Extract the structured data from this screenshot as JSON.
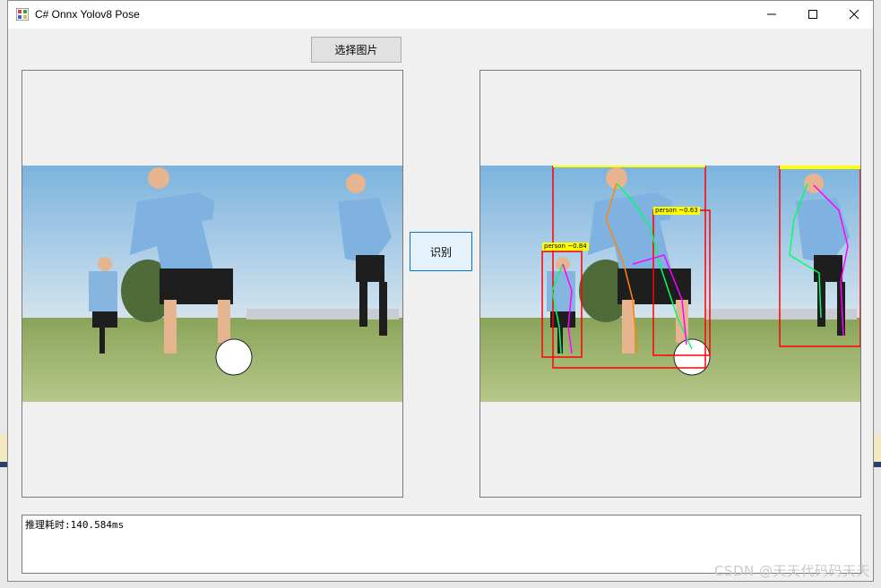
{
  "window": {
    "title": "C# Onnx Yolov8 Pose",
    "controls": [
      "minimize",
      "maximize",
      "close"
    ]
  },
  "buttons": {
    "select_image": "选择图片",
    "recognize": "识别"
  },
  "detections": {
    "labels": [
      "person ~0.63",
      "person ~0.84"
    ]
  },
  "output": {
    "text": "推理耗时:140.584ms"
  },
  "watermark": "CSDN @天天代码码天天",
  "colors": {
    "bbox": "#ff0000",
    "label_bg": "#ffff00",
    "button_focus": "#0078d7"
  }
}
